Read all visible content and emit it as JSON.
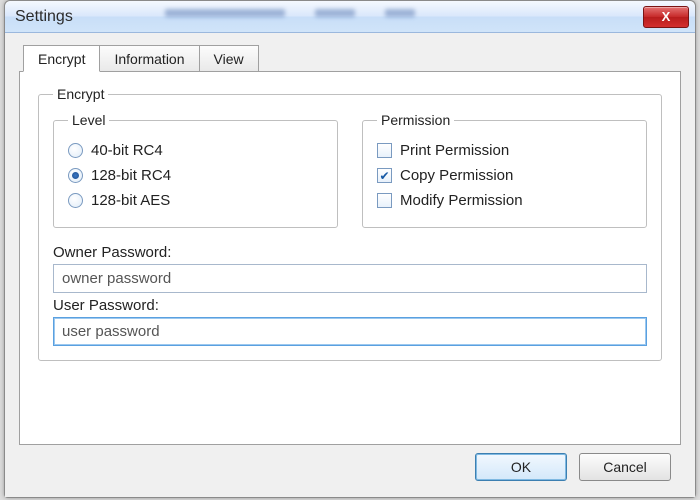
{
  "window": {
    "title": "Settings",
    "close_x": "X"
  },
  "tabs": [
    {
      "label": "Encrypt",
      "active": true
    },
    {
      "label": "Information",
      "active": false
    },
    {
      "label": "View",
      "active": false
    }
  ],
  "encrypt": {
    "group_label": "Encrypt",
    "level": {
      "group_label": "Level",
      "options": [
        {
          "label": "40-bit RC4",
          "selected": false
        },
        {
          "label": "128-bit RC4",
          "selected": true
        },
        {
          "label": "128-bit AES",
          "selected": false
        }
      ]
    },
    "permission": {
      "group_label": "Permission",
      "options": [
        {
          "label": "Print Permission",
          "checked": false
        },
        {
          "label": "Copy Permission",
          "checked": true
        },
        {
          "label": "Modify Permission",
          "checked": false
        }
      ]
    },
    "owner_password_label": "Owner Password:",
    "owner_password_value": "owner password",
    "user_password_label": "User Password:",
    "user_password_value": "user password"
  },
  "buttons": {
    "ok": "OK",
    "cancel": "Cancel"
  }
}
